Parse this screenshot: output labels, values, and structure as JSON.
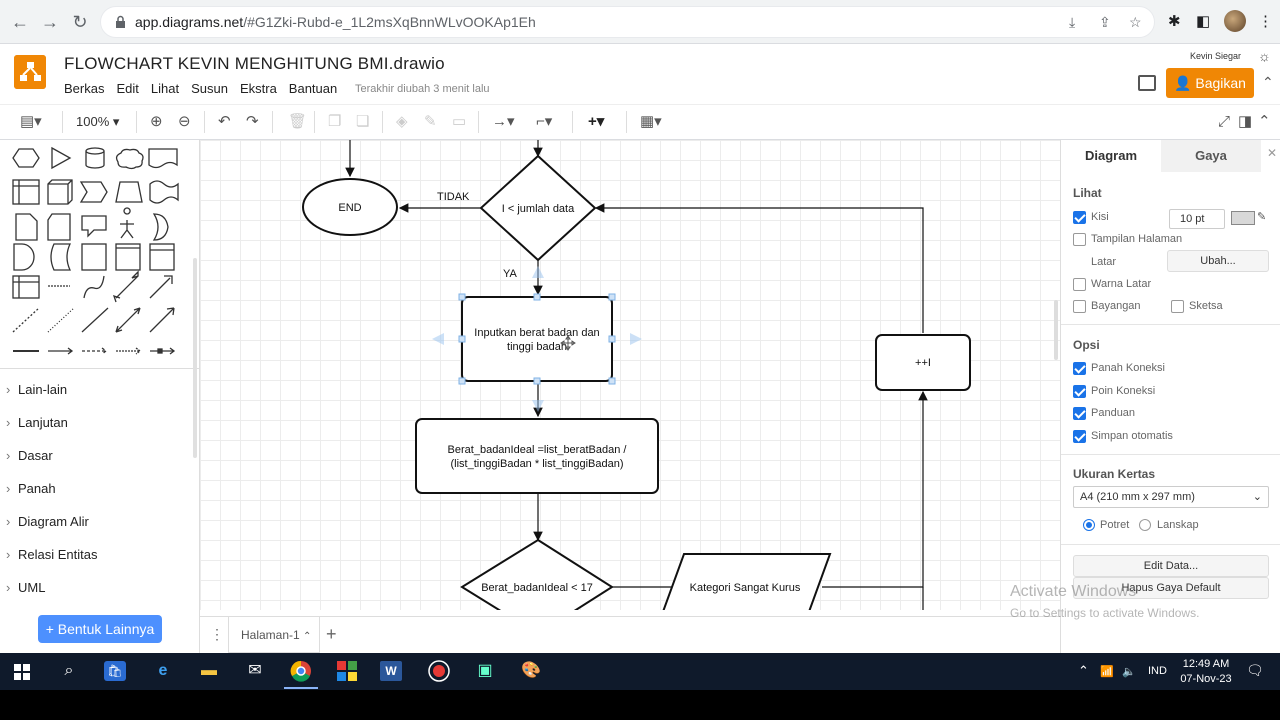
{
  "browser": {
    "url_host": "app.diagrams.net",
    "url_path": "/#G1Zki-Rubd-e_1L2msXqBnnWLvOOKAp1Eh"
  },
  "app": {
    "title": "FLOWCHART KEVIN MENGHITUNG BMI.drawio",
    "menu": [
      "Berkas",
      "Edit",
      "Lihat",
      "Susun",
      "Ekstra",
      "Bantuan"
    ],
    "last_saved": "Terakhir diubah 3 menit lalu",
    "user": "Kevin Siegar",
    "share_label": "Bagikan",
    "accent": "#f08705"
  },
  "toolbar": {
    "zoom": "100%"
  },
  "sidebar": {
    "categories": [
      "Lain-lain",
      "Lanjutan",
      "Dasar",
      "Panah",
      "Diagram Alir",
      "Relasi Entitas",
      "UML"
    ],
    "more_shapes": "Bentuk Lainnya"
  },
  "diagram": {
    "end_label": "END",
    "condition1": "I < jumlah data",
    "tidak": "TIDAK",
    "ya": "YA",
    "input_line1": "Inputkan berat badan dan",
    "input_line2": "tinggi badan",
    "process_line1": "Berat_badanIdeal =list_beratBadan /",
    "process_line2": "(list_tinggiBadan * list_tinggiBadan)",
    "increment": "++I",
    "condition2": "Berat_badanIdeal  < 17",
    "output1": "Kategori Sangat Kurus"
  },
  "pages": {
    "current": "Halaman-1"
  },
  "right_panel": {
    "tab_diagram": "Diagram",
    "tab_style": "Gaya",
    "view_title": "Lihat",
    "grid_label": "Kisi",
    "grid_size": "10 pt",
    "page_view": "Tampilan Halaman",
    "background": "Latar",
    "change": "Ubah...",
    "bg_color": "Warna Latar",
    "shadow": "Bayangan",
    "sketch": "Sketsa",
    "options_title": "Opsi",
    "options": [
      "Panah Koneksi",
      "Poin Koneksi",
      "Panduan",
      "Simpan otomatis"
    ],
    "paper_title": "Ukuran Kertas",
    "paper_size": "A4 (210 mm x 297 mm)",
    "portrait": "Potret",
    "landscape": "Lanskap",
    "edit_data": "Edit Data...",
    "clear_style": "Hapus Gaya Default"
  },
  "watermark": {
    "line1": "Activate Windows",
    "line2": "Go to Settings to activate Windows."
  },
  "taskbar": {
    "lang": "IND",
    "time": "12:49 AM",
    "date": "07-Nov-23"
  }
}
